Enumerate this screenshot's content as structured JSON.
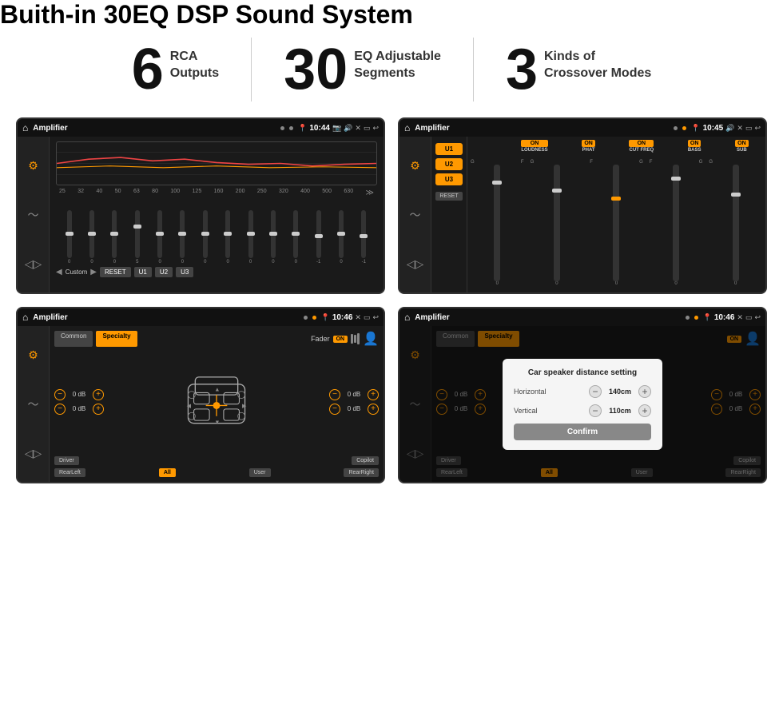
{
  "header": {
    "title": "Buith-in 30EQ DSP Sound System"
  },
  "stats": [
    {
      "number": "6",
      "text": "RCA\nOutputs"
    },
    {
      "number": "30",
      "text": "EQ Adjustable\nSegments"
    },
    {
      "number": "3",
      "text": "Kinds of\nCrossover Modes"
    }
  ],
  "screens": [
    {
      "id": "eq-screen",
      "statusBar": {
        "title": "Amplifier",
        "time": "10:44"
      },
      "type": "eq"
    },
    {
      "id": "crossover-screen",
      "statusBar": {
        "title": "Amplifier",
        "time": "10:45"
      },
      "type": "crossover"
    },
    {
      "id": "fader-screen",
      "statusBar": {
        "title": "Amplifier",
        "time": "10:46"
      },
      "type": "fader"
    },
    {
      "id": "dialog-screen",
      "statusBar": {
        "title": "Amplifier",
        "time": "10:46"
      },
      "type": "dialog"
    }
  ],
  "eq": {
    "frequencies": [
      "25",
      "32",
      "40",
      "50",
      "63",
      "80",
      "100",
      "125",
      "160",
      "200",
      "250",
      "320",
      "400",
      "500",
      "630"
    ],
    "values": [
      "0",
      "0",
      "0",
      "5",
      "0",
      "0",
      "0",
      "0",
      "0",
      "0",
      "0",
      "-1",
      "0",
      "-1"
    ],
    "presets": [
      "Custom",
      "RESET",
      "U1",
      "U2",
      "U3"
    ]
  },
  "crossover": {
    "presets": [
      "U1",
      "U2",
      "U3"
    ],
    "channels": [
      {
        "label": "ON",
        "name": "LOUDNESS"
      },
      {
        "label": "ON",
        "name": "PHAT"
      },
      {
        "label": "ON",
        "name": "CUT FREQ"
      },
      {
        "label": "ON",
        "name": "BASS"
      },
      {
        "label": "ON",
        "name": "SUB"
      }
    ],
    "resetLabel": "RESET"
  },
  "fader": {
    "tabs": [
      "Common",
      "Specialty"
    ],
    "faderLabel": "Fader",
    "onLabel": "ON",
    "dbValues": [
      "0 dB",
      "0 dB",
      "0 dB",
      "0 dB"
    ],
    "navButtons": [
      "Driver",
      "Copilot",
      "RearLeft",
      "All",
      "User",
      "RearRight"
    ]
  },
  "dialog": {
    "title": "Car speaker distance setting",
    "horizontal": {
      "label": "Horizontal",
      "value": "140cm"
    },
    "vertical": {
      "label": "Vertical",
      "value": "110cm"
    },
    "confirmLabel": "Confirm",
    "faderTabs": [
      "Common",
      "Specialty"
    ],
    "onLabel": "ON",
    "dbValues": [
      "0 dB",
      "0 dB"
    ],
    "navButtons": [
      "Driver",
      "Copilot",
      "RearLeft",
      "All",
      "User",
      "RearRight"
    ]
  }
}
